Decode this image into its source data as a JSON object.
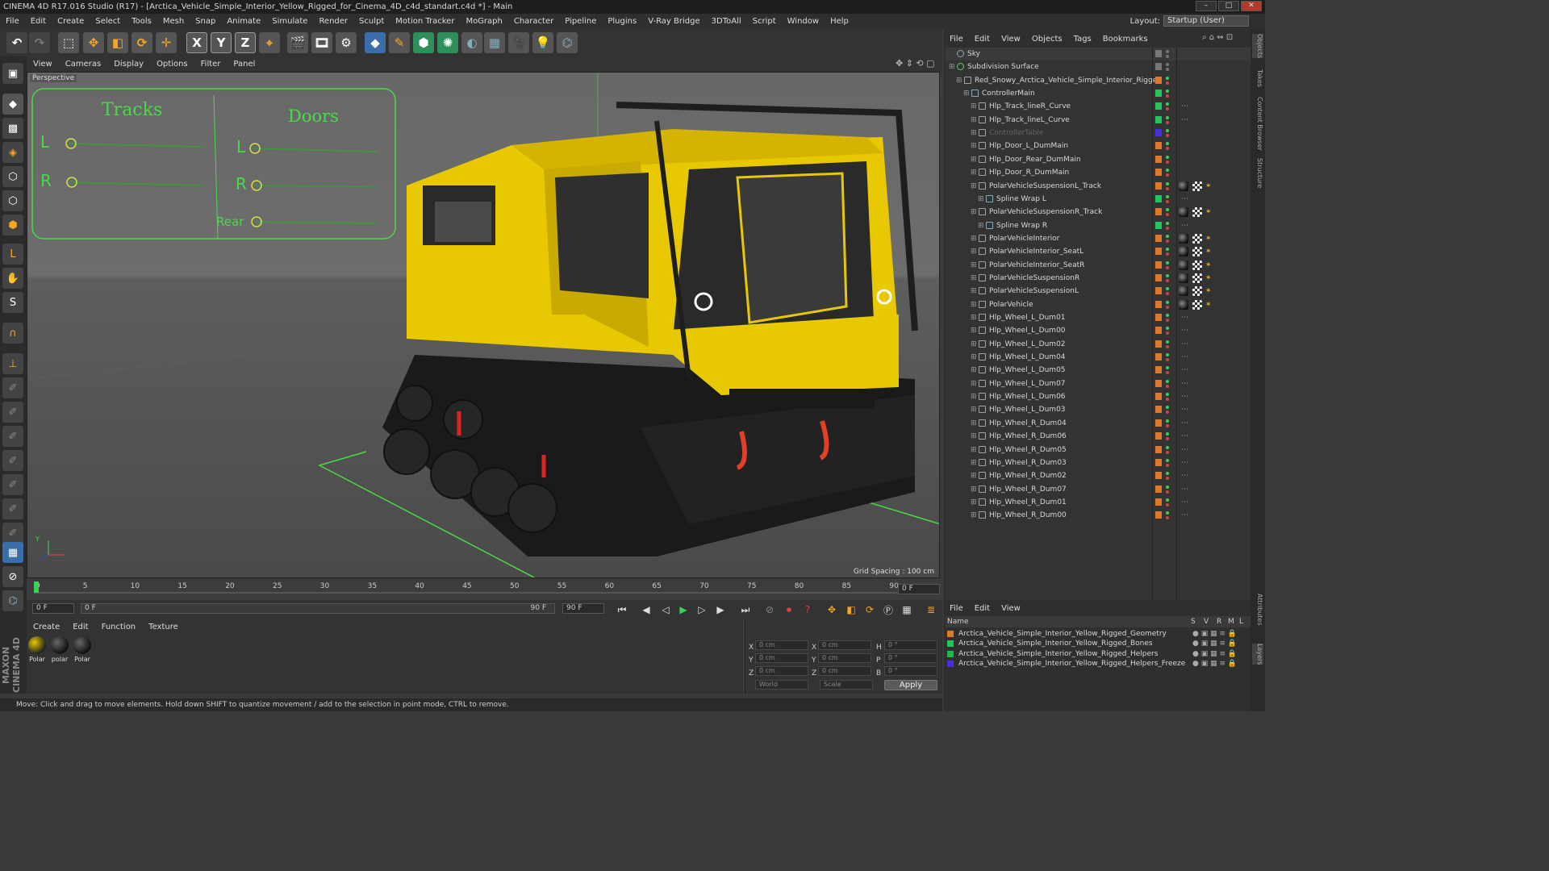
{
  "window": {
    "title": "CINEMA 4D R17.016 Studio (R17) - [Arctica_Vehicle_Simple_Interior_Yellow_Rigged_for_Cinema_4D_c4d_standart.c4d *] - Main"
  },
  "menu": [
    "File",
    "Edit",
    "Create",
    "Select",
    "Tools",
    "Mesh",
    "Snap",
    "Animate",
    "Simulate",
    "Render",
    "Sculpt",
    "Motion Tracker",
    "MoGraph",
    "Character",
    "Pipeline",
    "Plugins",
    "V-Ray Bridge",
    "3DToAll",
    "Script",
    "Window",
    "Help"
  ],
  "layout": {
    "label": "Layout:",
    "value": "Startup (User)"
  },
  "viewport": {
    "menu": [
      "View",
      "Cameras",
      "Display",
      "Options",
      "Filter",
      "Panel"
    ],
    "label": "Perspective",
    "grid_spacing": "Grid Spacing : 100 cm",
    "hud": {
      "tracks_title": "Tracks",
      "doors_title": "Doors",
      "l": "L",
      "r": "R",
      "rear": "Rear"
    }
  },
  "timeline": {
    "ticks": [
      "0",
      "5",
      "10",
      "15",
      "20",
      "25",
      "30",
      "35",
      "40",
      "45",
      "50",
      "55",
      "60",
      "65",
      "70",
      "75",
      "80",
      "85",
      "90"
    ],
    "current_frame": "0 F",
    "start": "0 F",
    "range_start": "0 F",
    "range_end": "90 F",
    "end": "90 F"
  },
  "materials": {
    "menu": [
      "Create",
      "Edit",
      "Function",
      "Texture"
    ],
    "items": [
      "Polar",
      "polar",
      "Polar"
    ]
  },
  "attributes": {
    "x_label": "X",
    "y_label": "Y",
    "z_label": "Z",
    "h_label": "H",
    "p_label": "P",
    "b_label": "B",
    "pos_x": "0 cm",
    "pos_y": "0 cm",
    "pos_z": "0 cm",
    "size_x": "0 cm",
    "size_y": "0 cm",
    "size_z": "0 cm",
    "rot_h": "0 °",
    "rot_p": "0 °",
    "rot_b": "0 °",
    "mode_world": "World",
    "mode_scale": "Scale",
    "apply": "Apply"
  },
  "status": "Move: Click and drag to move elements. Hold down SHIFT to quantize movement / add to the selection in point mode, CTRL to remove.",
  "object_manager": {
    "menu": [
      "File",
      "Edit",
      "View",
      "Objects",
      "Tags",
      "Bookmarks"
    ],
    "rows": [
      {
        "name": "Sky",
        "indent": 0
      },
      {
        "name": "Subdivision Surface",
        "indent": 0
      },
      {
        "name": "Red_Snowy_Arctica_Vehicle_Simple_Interior_Rigged",
        "indent": 1
      },
      {
        "name": "ControllerMain",
        "indent": 2
      },
      {
        "name": "Hlp_Track_lineR_Curve",
        "indent": 3
      },
      {
        "name": "Hlp_Track_lineL_Curve",
        "indent": 3
      },
      {
        "name": "ControllerTable",
        "indent": 3
      },
      {
        "name": "Hlp_Door_L_DumMain",
        "indent": 3
      },
      {
        "name": "Hlp_Door_Rear_DumMain",
        "indent": 3
      },
      {
        "name": "Hlp_Door_R_DumMain",
        "indent": 3
      },
      {
        "name": "PolarVehicleSuspensionL_Track",
        "indent": 3
      },
      {
        "name": "Spline Wrap L",
        "indent": 4
      },
      {
        "name": "PolarVehicleSuspensionR_Track",
        "indent": 3
      },
      {
        "name": "Spline Wrap R",
        "indent": 4
      },
      {
        "name": "PolarVehicleInterior",
        "indent": 3
      },
      {
        "name": "PolarVehicleInterior_SeatL",
        "indent": 3
      },
      {
        "name": "PolarVehicleInterior_SeatR",
        "indent": 3
      },
      {
        "name": "PolarVehicleSuspensionR",
        "indent": 3
      },
      {
        "name": "PolarVehicleSuspensionL",
        "indent": 3
      },
      {
        "name": "PolarVehicle",
        "indent": 3
      },
      {
        "name": "Hlp_Wheel_L_Dum01",
        "indent": 3
      },
      {
        "name": "Hlp_Wheel_L_Dum00",
        "indent": 3
      },
      {
        "name": "Hlp_Wheel_L_Dum02",
        "indent": 3
      },
      {
        "name": "Hlp_Wheel_L_Dum04",
        "indent": 3
      },
      {
        "name": "Hlp_Wheel_L_Dum05",
        "indent": 3
      },
      {
        "name": "Hlp_Wheel_L_Dum07",
        "indent": 3
      },
      {
        "name": "Hlp_Wheel_L_Dum06",
        "indent": 3
      },
      {
        "name": "Hlp_Wheel_L_Dum03",
        "indent": 3
      },
      {
        "name": "Hlp_Wheel_R_Dum04",
        "indent": 3
      },
      {
        "name": "Hlp_Wheel_R_Dum06",
        "indent": 3
      },
      {
        "name": "Hlp_Wheel_R_Dum05",
        "indent": 3
      },
      {
        "name": "Hlp_Wheel_R_Dum03",
        "indent": 3
      },
      {
        "name": "Hlp_Wheel_R_Dum02",
        "indent": 3
      },
      {
        "name": "Hlp_Wheel_R_Dum07",
        "indent": 3
      },
      {
        "name": "Hlp_Wheel_R_Dum01",
        "indent": 3
      },
      {
        "name": "Hlp_Wheel_R_Dum00",
        "indent": 3
      }
    ]
  },
  "layer_manager": {
    "menu": [
      "File",
      "Edit",
      "View"
    ],
    "header": {
      "name": "Name",
      "cols": [
        "S",
        "V",
        "R",
        "M",
        "L"
      ]
    },
    "layers": [
      {
        "name": "Arctica_Vehicle_Simple_Interior_Yellow_Rigged_Geometry",
        "color": "#e0782a"
      },
      {
        "name": "Arctica_Vehicle_Simple_Interior_Yellow_Rigged_Bones",
        "color": "#22c55e"
      },
      {
        "name": "Arctica_Vehicle_Simple_Interior_Yellow_Rigged_Helpers",
        "color": "#1fb84a"
      },
      {
        "name": "Arctica_Vehicle_Simple_Interior_Yellow_Rigged_Helpers_Freeze",
        "color": "#4a2ee0"
      }
    ]
  },
  "side_tabs": [
    "Objects",
    "Takes",
    "Content Browser",
    "Structure",
    "Attributes",
    "Layers"
  ],
  "brand": "MAXON CINEMA 4D",
  "colors": {
    "accent_green": "#39d353",
    "vehicle_yellow": "#f5d000",
    "hud_green": "#4bd94b"
  }
}
